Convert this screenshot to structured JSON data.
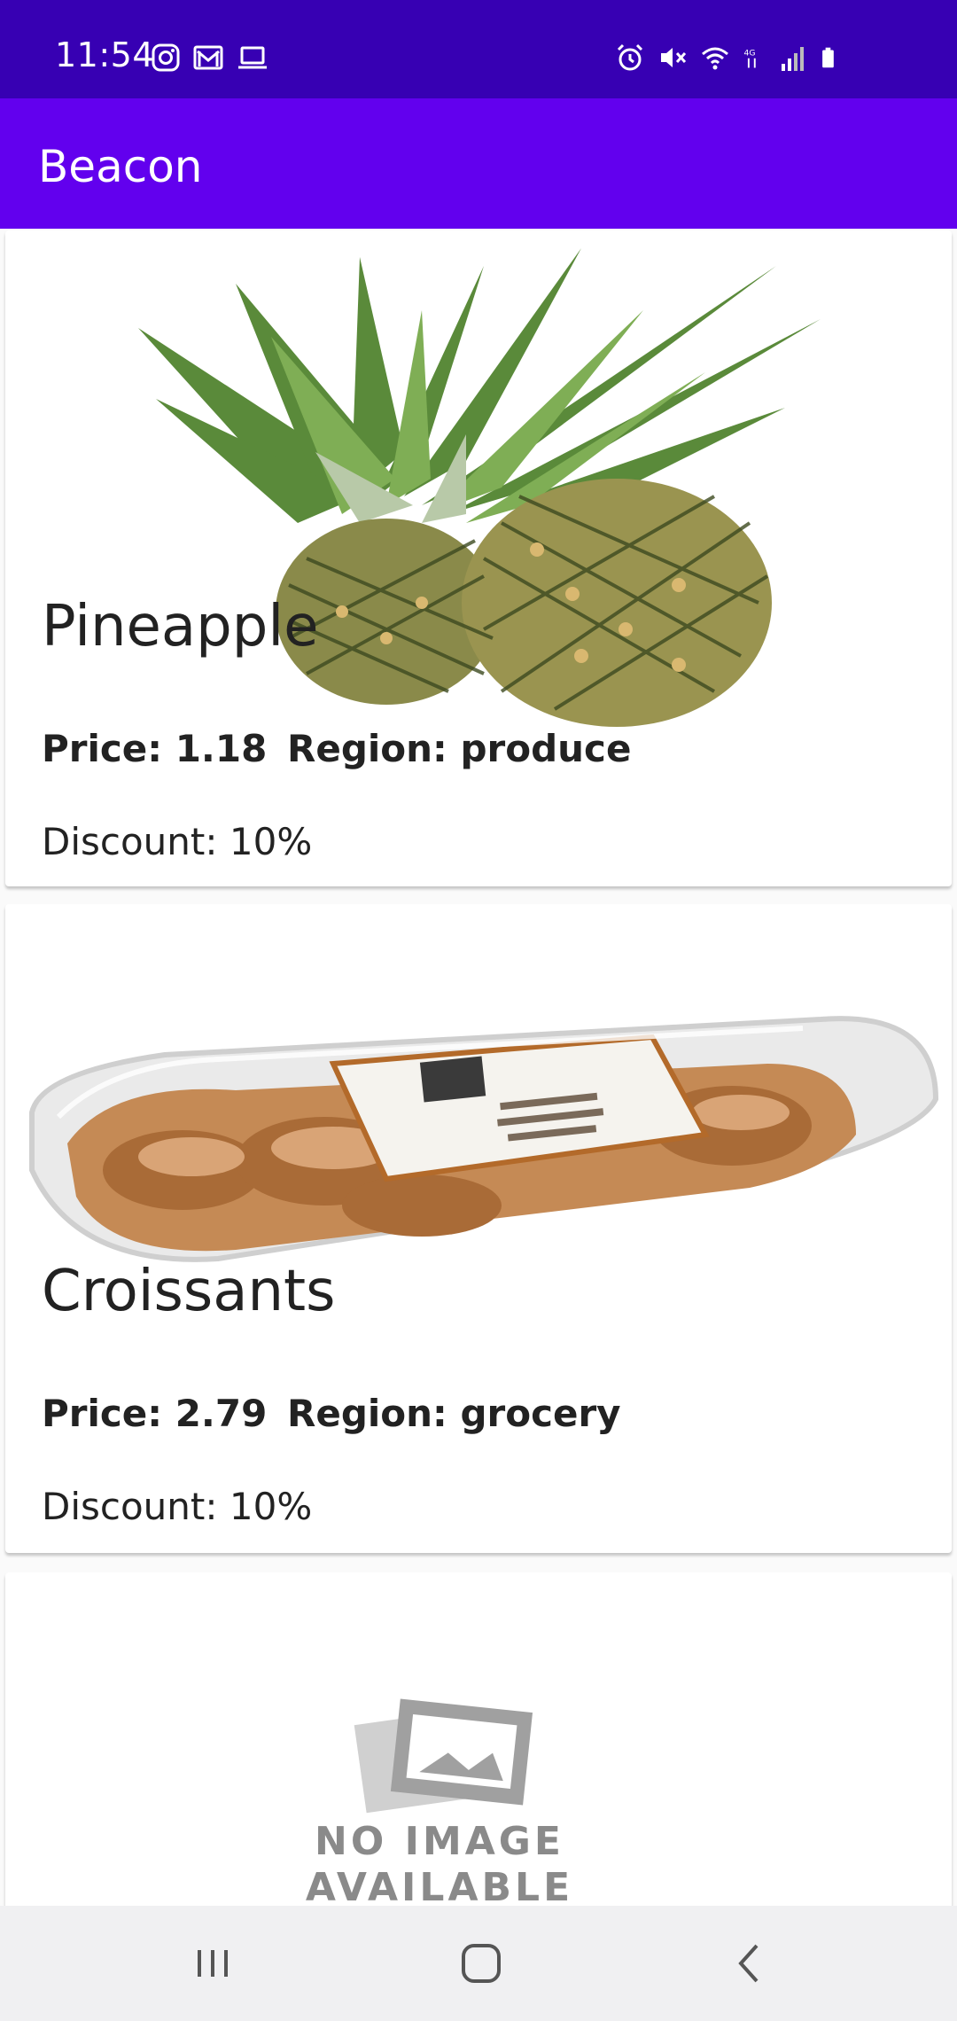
{
  "status_bar": {
    "time": "11:54",
    "left_icons": [
      "instagram-icon",
      "gmail-icon",
      "laptop-icon"
    ],
    "right_icons": [
      "alarm-icon",
      "mute-icon",
      "wifi-icon",
      "data-4g-icon",
      "signal-icon",
      "battery-icon"
    ],
    "background": "#3700b3"
  },
  "app_bar": {
    "title": "Beacon",
    "background": "#6200ee"
  },
  "products": [
    {
      "name": "Pineapple",
      "price_label": "Price: 1.18",
      "region_label": "Region: produce",
      "discount_label": "Discount: 10%",
      "image": "pineapple-image"
    },
    {
      "name": "Croissants",
      "price_label": "Price: 2.79",
      "region_label": "Region: grocery",
      "discount_label": "Discount: 10%",
      "image": "croissants-image"
    },
    {
      "image": "no-image-placeholder",
      "placeholder_text_1": "NO IMAGE",
      "placeholder_text_2": "AVAILABLE"
    }
  ],
  "nav_bar": {
    "buttons": [
      "recents-button",
      "home-button",
      "back-button"
    ]
  }
}
